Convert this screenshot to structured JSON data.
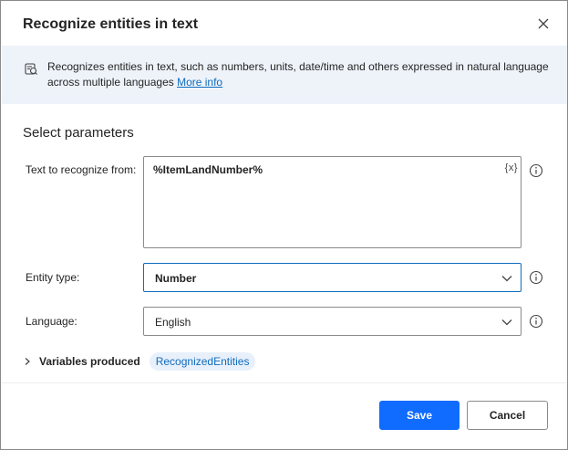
{
  "dialog": {
    "title": "Recognize entities in text",
    "close_icon": "close-icon"
  },
  "info": {
    "icon": "entity-recognition-icon",
    "text": "Recognizes entities in text, such as numbers, units, date/time and others expressed in natural language across multiple languages ",
    "link": "More info"
  },
  "parameters": {
    "section_title": "Select parameters",
    "text_to_recognize": {
      "label": "Text to recognize from:",
      "value": "%ItemLandNumber%",
      "variable_icon": "{x}"
    },
    "entity_type": {
      "label": "Entity type:",
      "value": "Number"
    },
    "language": {
      "label": "Language:",
      "value": "English"
    }
  },
  "variables": {
    "label": "Variables produced",
    "items": [
      "RecognizedEntities"
    ]
  },
  "footer": {
    "save_label": "Save",
    "cancel_label": "Cancel"
  },
  "colors": {
    "accent": "#0f6cff",
    "link": "#0f6cbd",
    "banner_bg": "#eef3fa",
    "chip_bg": "#e8f0fb"
  }
}
